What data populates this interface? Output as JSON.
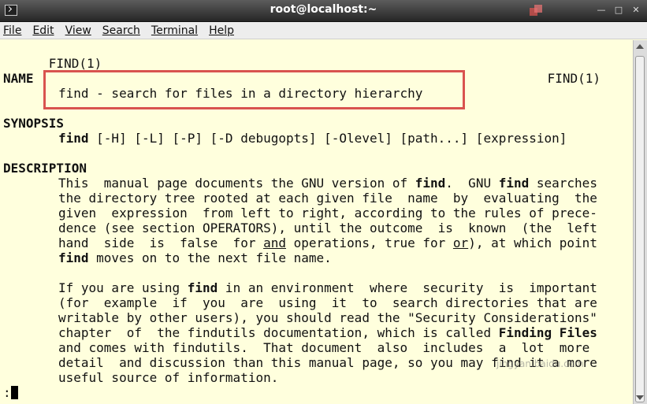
{
  "window": {
    "title": "root@localhost:~"
  },
  "menu": [
    "File",
    "Edit",
    "View",
    "Search",
    "Terminal",
    "Help"
  ],
  "man": {
    "header_left": "FIND(1)",
    "header_right": "FIND(1)",
    "name_heading": "NAME",
    "name_line": "find - search for files in a directory hierarchy",
    "synopsis_heading": "SYNOPSIS",
    "synopsis_cmd": "find",
    "synopsis_args": " [-H] [-L] [-P] [-D debugopts] [-Olevel] [path...] [expression]",
    "description_heading": "DESCRIPTION",
    "bold_find": "find",
    "bold_finding_files": "Finding Files",
    "underline_and": "and",
    "underline_or": "or",
    "para1": [
      "This  manual page documents the GNU version of ",
      ".  GNU ",
      " searches",
      "the directory tree rooted at each given file  name  by  evaluating  the",
      "given  expression  from left to right, according to the rules of prece-",
      "dence (see section OPERATORS), until the outcome  is  known  (the  left",
      "hand  side  is  false  for ",
      " operations, true for ",
      "), at which point",
      " moves on to the next file name."
    ],
    "para2": [
      "If you are using ",
      " in an environment  where  security  is  important",
      "(for  example  if  you  are  using  it  to  search directories that are",
      "writable by other users), you should read the \"Security Considerations\"",
      "chapter  of  the findutils documentation, which is called ",
      "and comes with findutils.  That document  also  includes  a  lot  more",
      "detail  and discussion than this manual page, so you may find it a more",
      "useful source of information."
    ],
    "prompt": ":"
  },
  "watermark": "jingyan.baidu.com"
}
